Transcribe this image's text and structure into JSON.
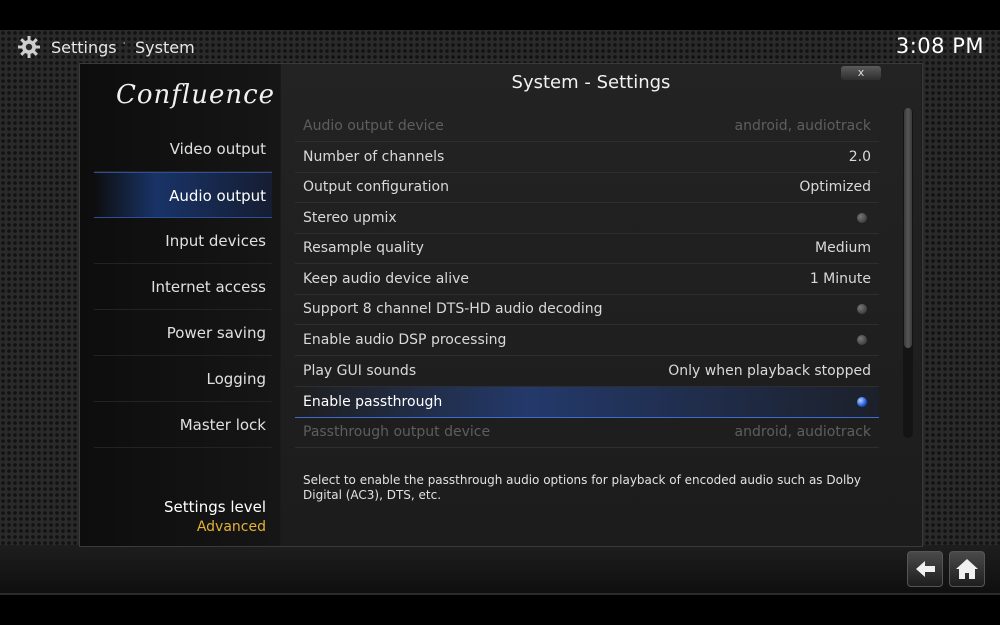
{
  "header": {
    "breadcrumb": [
      "Settings",
      "System"
    ],
    "separator": "·",
    "clock": "3:08 PM"
  },
  "sidebar": {
    "logo": "Confluence",
    "items": [
      {
        "label": "Video output",
        "active": false
      },
      {
        "label": "Audio output",
        "active": true
      },
      {
        "label": "Input devices",
        "active": false
      },
      {
        "label": "Internet access",
        "active": false
      },
      {
        "label": "Power saving",
        "active": false
      },
      {
        "label": "Logging",
        "active": false
      },
      {
        "label": "Master lock",
        "active": false
      }
    ],
    "settings_level": {
      "label": "Settings level",
      "value": "Advanced"
    }
  },
  "main": {
    "title": "System - Settings",
    "close_label": "x",
    "rows": [
      {
        "label": "Audio output device",
        "value": "android, audiotrack",
        "disabled": true
      },
      {
        "label": "Number of channels",
        "value": "2.0"
      },
      {
        "label": "Output configuration",
        "value": "Optimized"
      },
      {
        "label": "Stereo upmix",
        "radio": "off"
      },
      {
        "label": "Resample quality",
        "value": "Medium"
      },
      {
        "label": "Keep audio device alive",
        "value": "1 Minute"
      },
      {
        "label": "Support 8 channel DTS-HD audio decoding",
        "radio": "off"
      },
      {
        "label": "Enable audio DSP processing",
        "radio": "off"
      },
      {
        "label": "Play GUI sounds",
        "value": "Only when playback stopped"
      },
      {
        "label": "Enable passthrough",
        "radio": "on",
        "focused": true
      },
      {
        "label": "Passthrough output device",
        "value": "android, audiotrack",
        "disabled": true
      }
    ],
    "hint": "Select to enable the passthrough audio options for playback of encoded audio such as Dolby Digital (AC3), DTS, etc."
  },
  "footer": {
    "back_icon": "back-arrow-icon",
    "home_icon": "home-icon"
  },
  "colors": {
    "accent": "#2f6ee0",
    "settings_level_value": "#e3b234"
  }
}
